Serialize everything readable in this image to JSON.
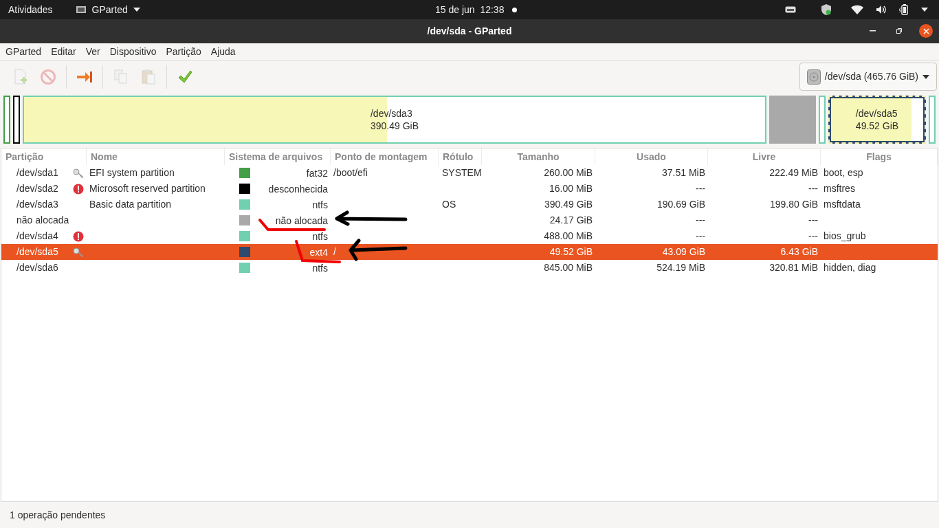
{
  "top_bar": {
    "activities": "Atividades",
    "app_menu": "GParted",
    "clock": "15 de jun  12:38"
  },
  "window": {
    "title": "/dev/sda - GParted"
  },
  "menu": [
    "GParted",
    "Editar",
    "Ver",
    "Dispositivo",
    "Partição",
    "Ajuda"
  ],
  "toolbar": {
    "buttons": [
      {
        "kind": "new",
        "disabled": true
      },
      {
        "kind": "delete",
        "disabled": true
      },
      {
        "kind": "resize",
        "disabled": false
      },
      {
        "kind": "copy",
        "disabled": true
      },
      {
        "kind": "paste",
        "disabled": true
      },
      {
        "kind": "apply",
        "disabled": false
      }
    ],
    "device": "/dev/sda (465.76 GiB)"
  },
  "disk_map": [
    {
      "color": "#43a047",
      "selected": false
    },
    {
      "color": "#000000",
      "selected": false
    },
    {
      "color": "#70d0b0",
      "level": 0.49,
      "selected": false,
      "name": "/dev/sda3",
      "size": "390.49 GiB"
    },
    {
      "color": "#a9a9a9",
      "kind": "unallocated",
      "selected": false
    },
    {
      "color": "#70d0b0",
      "selected": false
    },
    {
      "color": "#2e4a6e",
      "level": 0.87,
      "selected": true,
      "name": "/dev/sda5",
      "size": "49.52 GiB"
    },
    {
      "color": "#70d0b0",
      "selected": false
    }
  ],
  "table": {
    "columns": [
      "Partição",
      "Nome",
      "Sistema de arquivos",
      "Ponto de montagem",
      "Rótulo",
      "Tamanho",
      "Usado",
      "Livre",
      "Flags"
    ],
    "rows": [
      {
        "partition": "/dev/sda1",
        "kind": "mounted",
        "name": "EFI system partition",
        "color": "#43a047",
        "fs": "fat32",
        "mount": "/boot/efi",
        "label": "SYSTEM",
        "size": "260.00 MiB",
        "used": "37.51 MiB",
        "free": "222.49 MiB",
        "flags": "boot, esp",
        "selected": false
      },
      {
        "partition": "/dev/sda2",
        "kind": "error",
        "name": "Microsoft reserved partition",
        "color": "#000000",
        "fs": "desconhecida",
        "size": "16.00 MiB",
        "used": "---",
        "free": "---",
        "flags": "msftres",
        "selected": false
      },
      {
        "partition": "/dev/sda3",
        "name": "Basic data partition",
        "color": "#70d0b0",
        "fs": "ntfs",
        "label": "OS",
        "size": "390.49 GiB",
        "used": "190.69 GiB",
        "free": "199.80 GiB",
        "flags": "msftdata",
        "selected": false
      },
      {
        "partition": "não alocada",
        "color": "#a9a9a9",
        "fs": "não alocada",
        "size": "24.17 GiB",
        "used": "---",
        "free": "---",
        "selected": false
      },
      {
        "partition": "/dev/sda4",
        "kind": "error",
        "color": "#70d0b0",
        "fs": "ntfs",
        "size": "488.00 MiB",
        "used": "---",
        "free": "---",
        "flags": "bios_grub",
        "selected": false
      },
      {
        "partition": "/dev/sda5",
        "kind": "mounted",
        "color": "#2e4a6e",
        "fs": "ext4",
        "mount": "/",
        "size": "49.52 GiB",
        "used": "43.09 GiB",
        "free": "6.43 GiB",
        "selected": true
      },
      {
        "partition": "/dev/sda6",
        "color": "#70d0b0",
        "fs": "ntfs",
        "size": "845.00 MiB",
        "used": "524.19 MiB",
        "free": "320.81 MiB",
        "flags": "hidden, diag",
        "selected": false
      }
    ]
  },
  "status_bar": "1 operação pendentes"
}
